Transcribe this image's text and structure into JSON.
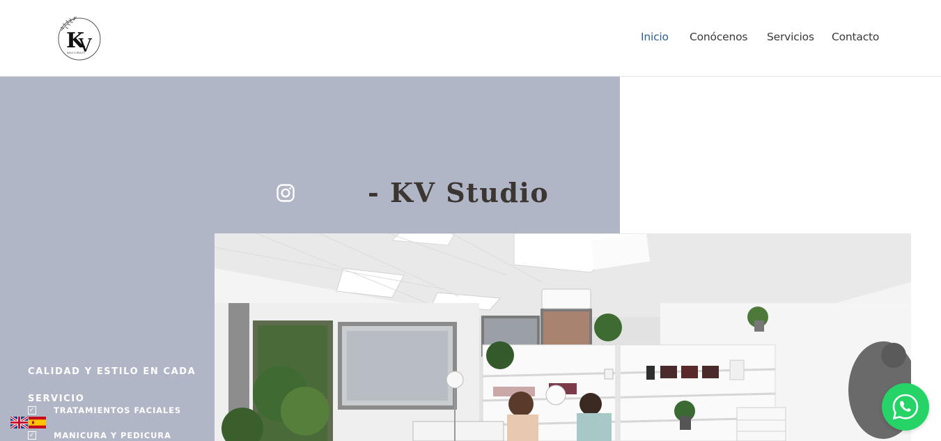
{
  "header": {
    "logo_text": "KV",
    "logo_subtext": "NAILS & BEAUTY",
    "nav": [
      {
        "label": "Inicio",
        "active": true
      },
      {
        "label": "Conócenos",
        "active": false
      },
      {
        "label": "Servicios",
        "active": false
      },
      {
        "label": "Contacto",
        "active": false
      }
    ]
  },
  "hero": {
    "title": "- KV Studio",
    "instagram_icon": "instagram-icon",
    "photo_description_icon": "studio-photo"
  },
  "sidebar": {
    "tagline": "CALIDAD Y ESTILO EN CADA SERVICIO",
    "services": [
      "TRATAMIENTOS FACIALES",
      "MANICURA Y PEDICURA"
    ]
  },
  "language_flags": [
    "english-flag",
    "spanish-flag"
  ],
  "whatsapp": {
    "icon": "whatsapp-icon"
  },
  "colors": {
    "accent": "#2f5f9e",
    "panel": "#b1b6c7",
    "title": "#3b3631",
    "whatsapp": "#25d366"
  }
}
